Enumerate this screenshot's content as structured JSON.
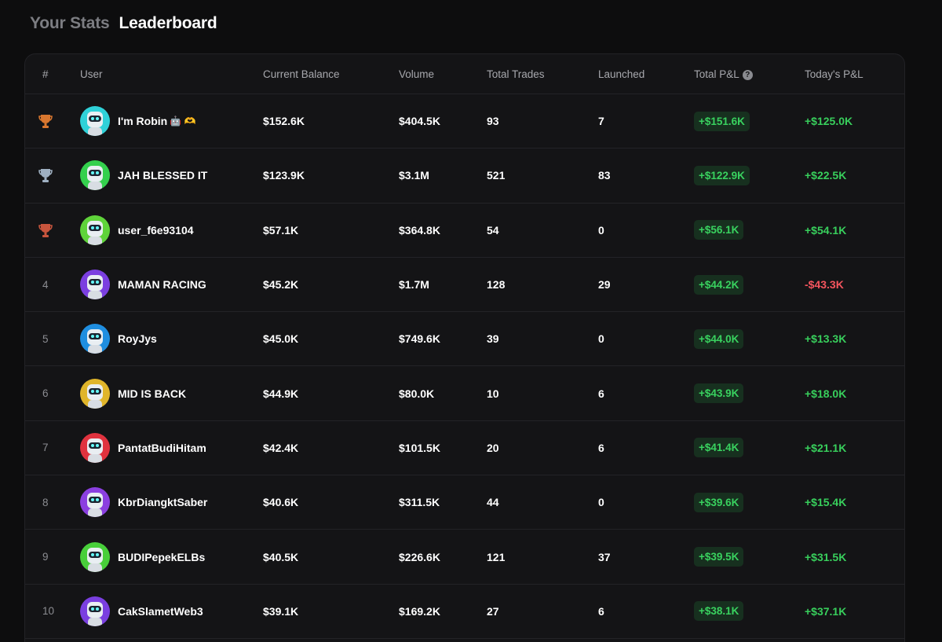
{
  "tabs": [
    {
      "label": "Your Stats",
      "active": false
    },
    {
      "label": "Leaderboard",
      "active": true
    }
  ],
  "columns": {
    "rank": "#",
    "user": "User",
    "balance": "Current Balance",
    "volume": "Volume",
    "trades": "Total Trades",
    "launched": "Launched",
    "total_pnl": "Total P&L",
    "today_pnl": "Today's P&L"
  },
  "total_pnl_help_icon": "question-icon",
  "rows": [
    {
      "rank": "1",
      "trophy": "gold",
      "name": "I'm Robin",
      "emoji": "🤖 🫶",
      "avatar_color": "#2fd1d8",
      "balance": "$152.6K",
      "volume": "$404.5K",
      "trades": "93",
      "launched": "7",
      "total_pnl": "+$151.6K",
      "today_pnl": "+$125.0K",
      "today_sign": "pos"
    },
    {
      "rank": "2",
      "trophy": "silver",
      "name": "JAH BLESSED IT",
      "emoji": "",
      "avatar_color": "#34d04d",
      "balance": "$123.9K",
      "volume": "$3.1M",
      "trades": "521",
      "launched": "83",
      "total_pnl": "+$122.9K",
      "today_pnl": "+$22.5K",
      "today_sign": "pos"
    },
    {
      "rank": "3",
      "trophy": "bronze",
      "name": "user_f6e93104",
      "emoji": "",
      "avatar_color": "#5fd33a",
      "balance": "$57.1K",
      "volume": "$364.8K",
      "trades": "54",
      "launched": "0",
      "total_pnl": "+$56.1K",
      "today_pnl": "+$54.1K",
      "today_sign": "pos"
    },
    {
      "rank": "4",
      "trophy": "",
      "name": "MAMAN RACING",
      "emoji": "",
      "avatar_color": "#7b3fe0",
      "balance": "$45.2K",
      "volume": "$1.7M",
      "trades": "128",
      "launched": "29",
      "total_pnl": "+$44.2K",
      "today_pnl": "-$43.3K",
      "today_sign": "neg"
    },
    {
      "rank": "5",
      "trophy": "",
      "name": "RoyJys",
      "emoji": "",
      "avatar_color": "#1f8ee0",
      "balance": "$45.0K",
      "volume": "$749.6K",
      "trades": "39",
      "launched": "0",
      "total_pnl": "+$44.0K",
      "today_pnl": "+$13.3K",
      "today_sign": "pos"
    },
    {
      "rank": "6",
      "trophy": "",
      "name": "MID IS BACK",
      "emoji": "",
      "avatar_color": "#e0b52a",
      "balance": "$44.9K",
      "volume": "$80.0K",
      "trades": "10",
      "launched": "6",
      "total_pnl": "+$43.9K",
      "today_pnl": "+$18.0K",
      "today_sign": "pos"
    },
    {
      "rank": "7",
      "trophy": "",
      "name": "PantatBudiHitam",
      "emoji": "",
      "avatar_color": "#e0323e",
      "balance": "$42.4K",
      "volume": "$101.5K",
      "trades": "20",
      "launched": "6",
      "total_pnl": "+$41.4K",
      "today_pnl": "+$21.1K",
      "today_sign": "pos"
    },
    {
      "rank": "8",
      "trophy": "",
      "name": "KbrDiangktSaber",
      "emoji": "",
      "avatar_color": "#8b3fe0",
      "balance": "$40.6K",
      "volume": "$311.5K",
      "trades": "44",
      "launched": "0",
      "total_pnl": "+$39.6K",
      "today_pnl": "+$15.4K",
      "today_sign": "pos"
    },
    {
      "rank": "9",
      "trophy": "",
      "name": "BUDIPepekELBs",
      "emoji": "",
      "avatar_color": "#48cf3a",
      "balance": "$40.5K",
      "volume": "$226.6K",
      "trades": "121",
      "launched": "37",
      "total_pnl": "+$39.5K",
      "today_pnl": "+$31.5K",
      "today_sign": "pos"
    },
    {
      "rank": "10",
      "trophy": "",
      "name": "CakSlametWeb3",
      "emoji": "",
      "avatar_color": "#7a3fe0",
      "balance": "$39.1K",
      "volume": "$169.2K",
      "trades": "27",
      "launched": "6",
      "total_pnl": "+$38.1K",
      "today_pnl": "+$37.1K",
      "today_sign": "pos"
    }
  ],
  "colors": {
    "background": "#0d0d0e",
    "card": "#141416",
    "positive": "#38cf5c",
    "negative": "#f4555e",
    "pnl_badge_bg": "#17301f",
    "trophy_gold": "#d9772f",
    "trophy_silver": "#9fb0c2",
    "trophy_bronze": "#c8553d"
  }
}
